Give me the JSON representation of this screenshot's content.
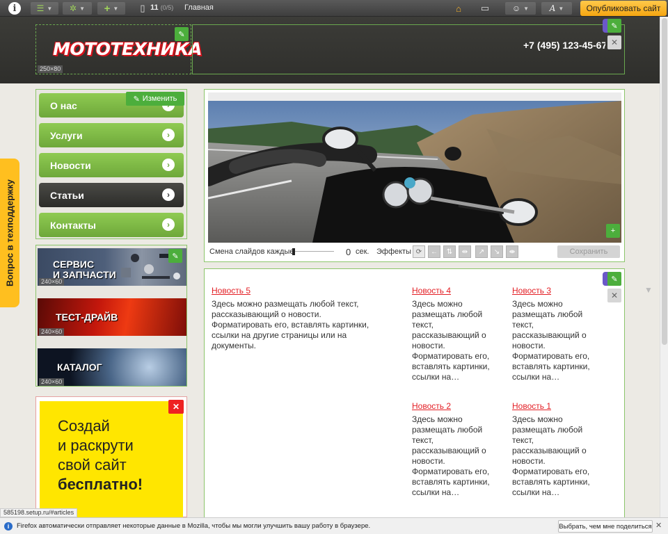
{
  "toolbar": {
    "page_count": "11",
    "page_count_sub": "(0/5)",
    "page_name": "Главная",
    "publish_label": "Опубликовать сайт"
  },
  "header": {
    "logo_text": "МОТОТЕХНИКА",
    "logo_size": "250×80",
    "phone": "+7 (495) 123-45-67"
  },
  "support_tab": {
    "label": "Вопрос в техподдержку"
  },
  "menu": {
    "edit_label": "Изменить",
    "items": [
      {
        "label": "О нас"
      },
      {
        "label": "Услуги"
      },
      {
        "label": "Новости"
      },
      {
        "label": "Статьи"
      },
      {
        "label": "Контакты"
      }
    ]
  },
  "banners": [
    {
      "line1": "СЕРВИС",
      "line2": "И ЗАПЧАСТИ",
      "size": "240×60"
    },
    {
      "line1": "ТЕСТ-ДРАЙВ",
      "line2": "",
      "size": "240×60"
    },
    {
      "line1": "КАТАЛОГ",
      "line2": "",
      "size": "240×60"
    }
  ],
  "ad": {
    "line1": "Создай",
    "line2": "и раскрути",
    "line3": "свой сайт",
    "line4": "бесплатно!"
  },
  "slider": {
    "interval_label": "Смена слайдов каждые",
    "interval_value": "0",
    "interval_unit": "сек.",
    "effects_label": "Эффекты",
    "save_label": "Сохранить"
  },
  "news": [
    {
      "title": "Новость 5",
      "text": "Здесь можно размещать любой текст, рассказывающий о новости. Форматировать его, вставлять картинки, ссылки на другие страницы или на документы."
    },
    {
      "title": "Новость 4",
      "text": "Здесь можно размещать любой текст, рассказывающий о новости. Форматировать его, вставлять картинки, ссылки на…"
    },
    {
      "title": "Новость 3",
      "text": "Здесь можно размещать любой текст, рассказывающий о новости. Форматировать его, вставлять картинки, ссылки на…"
    },
    {
      "title": "Новость 2",
      "text": "Здесь можно размещать любой текст, рассказывающий о новости. Форматировать его, вставлять картинки, ссылки на…"
    },
    {
      "title": "Новость 1",
      "text": "Здесь можно размещать любой текст, рассказывающий о новости. Форматировать его, вставлять картинки, ссылки на…"
    }
  ],
  "status_url": "585198.setup.ru/#articles",
  "infobar": {
    "text": "Firefox автоматически отправляет некоторые данные в Mozilla, чтобы мы могли улучшить вашу работу в браузере.",
    "button_label": "Выбрать, чем мне поделиться"
  }
}
